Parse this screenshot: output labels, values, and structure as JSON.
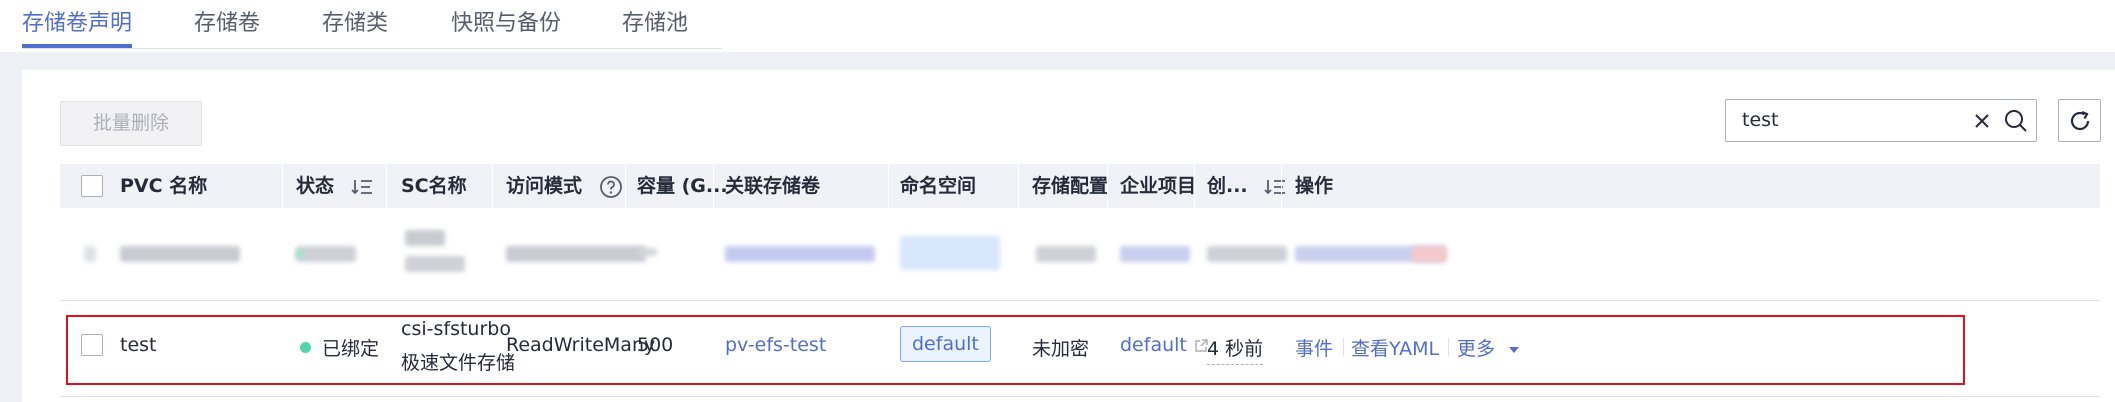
{
  "tabs": [
    {
      "label": "存储卷声明",
      "active": true
    },
    {
      "label": "存储卷",
      "active": false
    },
    {
      "label": "存储类",
      "active": false
    },
    {
      "label": "快照与备份",
      "active": false
    },
    {
      "label": "存储池",
      "active": false
    }
  ],
  "toolbar": {
    "batch_delete_label": "批量删除",
    "search_value": "test",
    "clear_icon": "close-icon",
    "search_icon": "search-icon",
    "refresh_icon": "refresh-icon"
  },
  "table": {
    "headers": {
      "pvc_name": "PVC 名称",
      "status": "状态",
      "sc_name": "SC名称",
      "access_mode": "访问模式",
      "capacity": "容量 (G...",
      "volume": "关联存储卷",
      "namespace": "命名空间",
      "encryption": "存储配置",
      "enterprise_project": "企业项目",
      "created": "创...",
      "operations": "操作"
    },
    "rows": [
      {
        "pvc_name": "test",
        "status": "已绑定",
        "status_color": "#50d4ab",
        "sc_name_line1": "csi-sfsturbo",
        "sc_name_line2": "极速文件存储",
        "access_mode": "ReadWriteMany",
        "capacity": "500",
        "volume": "pv-efs-test",
        "namespace": "default",
        "encryption": "未加密",
        "enterprise_project": "default",
        "created": "4 秒前",
        "ops": {
          "events": "事件",
          "view_yaml": "查看YAML",
          "more": "更多"
        }
      }
    ]
  },
  "colors": {
    "accent": "#526ecc",
    "highlight": "#e0131c",
    "status_bound": "#50d4ab"
  }
}
